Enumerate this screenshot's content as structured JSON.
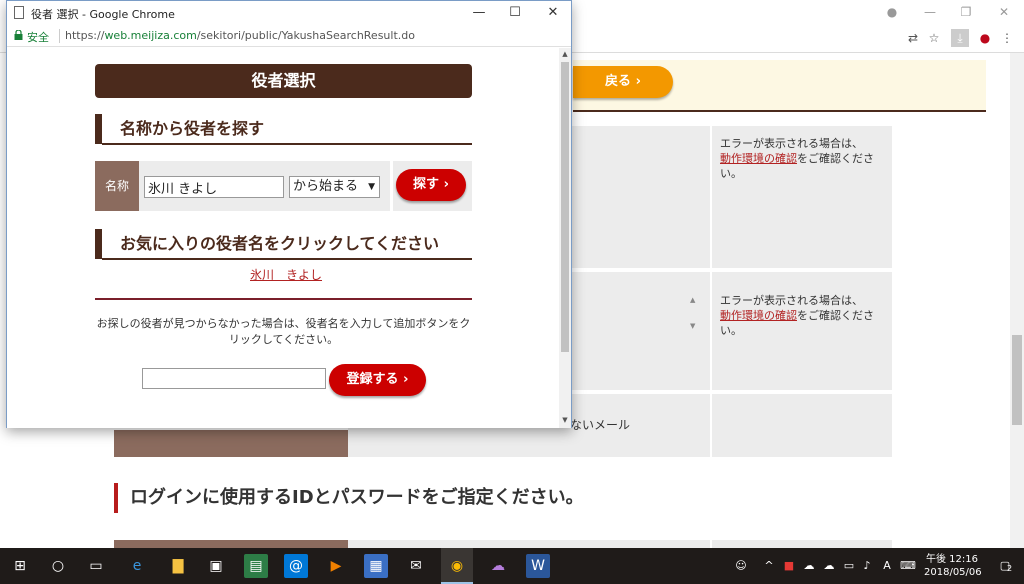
{
  "popup": {
    "title": "役者 選択 - Google Chrome",
    "secure_label": "安全",
    "url_scheme": "https://",
    "url_host": "web.meijiza.com",
    "url_path": "/sekitori/public/YakushaSearchResult.do",
    "heading": "役者選択",
    "search_section_title": "名称から役者を探す",
    "name_label": "名称",
    "name_value": "氷川 きよし",
    "match_select_value": "から始まる",
    "search_button": "探す",
    "favorites_section_title": "お気に入りの役者名をクリックしてください",
    "favorite_result": "氷川　きよし",
    "not_found_text": "お探しの役者が見つからなかった場合は、役者名を入力して追加ボタンをクリックしてください。",
    "register_button": "登録する"
  },
  "background": {
    "back_button": "戻る",
    "error_note_prefix": "エラーが表示される場合は、",
    "error_note_link": "動作環境の確認",
    "error_note_suffix": "をご確認ください。",
    "mail_text": "ないメール",
    "section_title": "ログインに使用するIDとパスワードをご指定ください。"
  },
  "taskbar": {
    "time": "午後 12:16",
    "date": "2018/05/06",
    "notification_count": "2"
  },
  "colors": {
    "brand_brown": "#4b2a1c",
    "label_brown": "#8b6b5e",
    "action_red": "#cc0000",
    "back_orange": "#f39800",
    "link_red": "#b22222"
  }
}
